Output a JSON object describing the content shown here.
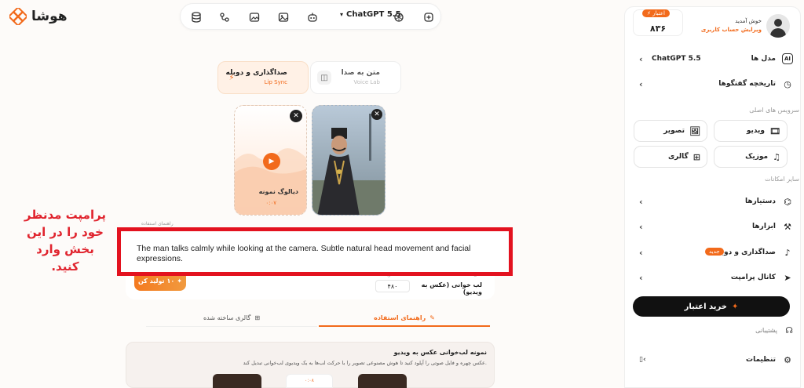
{
  "brand": {
    "name": "هوشا",
    "accent": "#f26a1b",
    "annotation_color": "#e3121f"
  },
  "toolbar": {
    "model": "ChatGPT 5.5",
    "icons": [
      "db-icon",
      "connect-icon",
      "image-gen-icon",
      "image-edit-icon",
      "robot-icon",
      "chevron-down-icon",
      "openai-icon",
      "new-chat-icon"
    ]
  },
  "account": {
    "credit_badge": "اعتبار",
    "credit_value": "۸۳۶",
    "welcome": "خوش آمدید",
    "edit_account": "ویرایش حساب کاربری"
  },
  "sidebar": {
    "model_label": "مدل ها",
    "model_value": "ChatGPT 5.5",
    "history": "تاریخچه گفتگوها",
    "main_services_title": "سرویس های اصلی",
    "services": {
      "video": "ویدیو",
      "image": "تصویر",
      "music": "موزیک",
      "gallery": "گالری"
    },
    "other_title": "سایر امکانات",
    "assistants": "دستیارها",
    "tools": "ابزارها",
    "voice_dub": "صداگذاری و دوبله",
    "new_badge": "جدید",
    "prompt_channel": "کانال پرامپت",
    "buy_credit": "خرید اعتبار",
    "support": "پشتیبانی",
    "settings": "تنظیمات"
  },
  "modes": {
    "tts_title": "متن به صدا",
    "tts_sub": "Voice Lab",
    "lipsync_title": "صداگذاری و دوبله",
    "lipsync_sub": "Lip Sync"
  },
  "media": {
    "sample_dialog": "دیالوگ نمونه",
    "sample_duration": "۰:۰۷"
  },
  "annotation": {
    "text": "پرامپت مدنظر خود را در این بخش وارد کنید."
  },
  "prompt": {
    "text": "The man talks calmly while looking at the camera. Subtle natural head movement and facial expressions.",
    "guide_label": "راهنمای استفاده"
  },
  "controls": {
    "generate": "تولید کن",
    "generate_cost": "۱۰",
    "mode_tag": "مدل",
    "mode_label": "لب خوانی (عکس به ویدیو)",
    "cost_label": "هزینه",
    "cost_value": "۴۸۰"
  },
  "tabs": {
    "guide": "راهنمای استفاده",
    "gallery": "گالری ساخته شده"
  },
  "guide": {
    "title": "نمونه لب‌خوانی عکس به ویدیو",
    "description": "عکس چهره و فایل صوتی را آپلود کنید تا هوش مصنوعی تصویر را با حرکت لب‌ها به یک ویدیوی لب‌خوانی تبدیل کند.",
    "mid_time": "۰:۰۸"
  }
}
